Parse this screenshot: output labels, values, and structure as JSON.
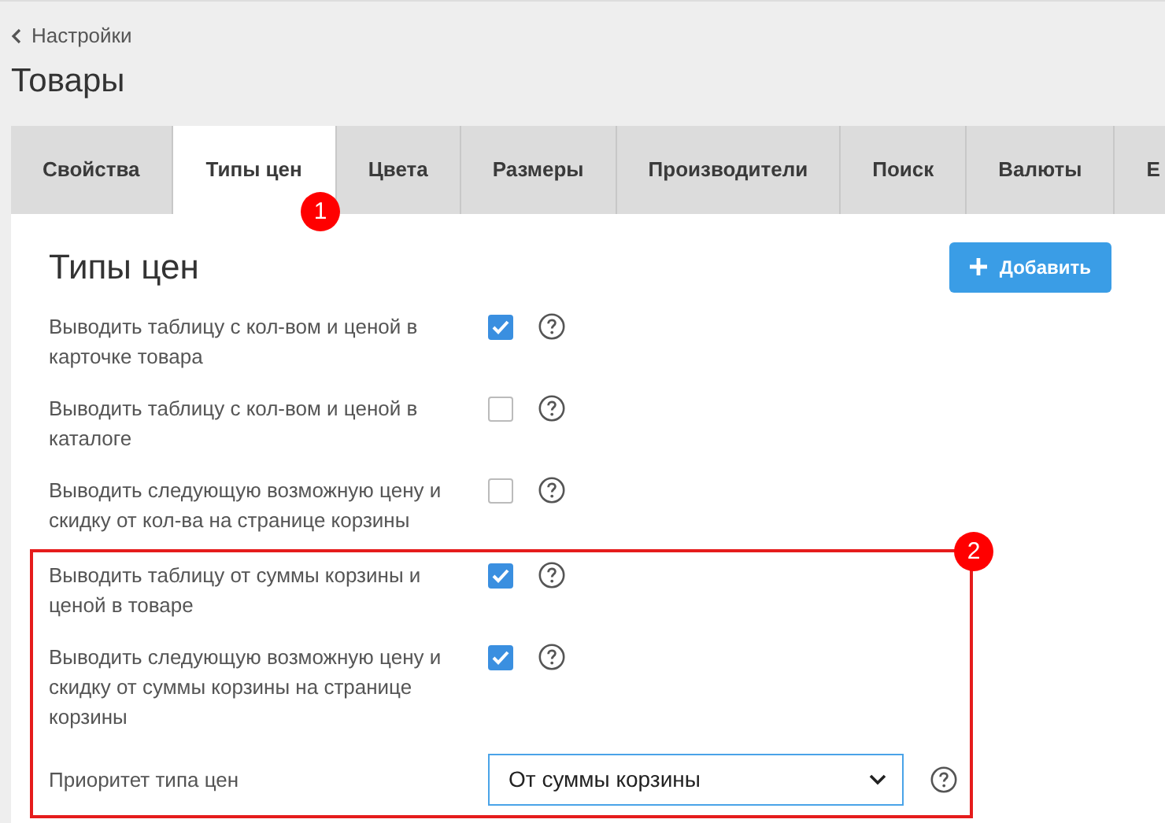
{
  "breadcrumb": {
    "label": "Настройки"
  },
  "title": "Товары",
  "tabs": [
    {
      "label": "Свойства",
      "selected": false
    },
    {
      "label": "Типы цен",
      "selected": true
    },
    {
      "label": "Цвета",
      "selected": false
    },
    {
      "label": "Размеры",
      "selected": false
    },
    {
      "label": "Производители",
      "selected": false
    },
    {
      "label": "Поиск",
      "selected": false
    },
    {
      "label": "Валюты",
      "selected": false
    },
    {
      "label": "Е",
      "selected": false
    }
  ],
  "tab_callout": "1",
  "section": {
    "title": "Типы цен",
    "add_button": "Добавить"
  },
  "settings": [
    {
      "kind": "checkbox",
      "label": "Выводить таблицу с кол-вом и ценой в карточке товара",
      "checked": true
    },
    {
      "kind": "checkbox",
      "label": "Выводить таблицу с кол-вом и ценой в каталоге",
      "checked": false
    },
    {
      "kind": "checkbox",
      "label": "Выводить следующую возможную цену и скидку от кол-ва на странице корзины",
      "checked": false
    }
  ],
  "highlighted_group": {
    "callout": "2",
    "settings": [
      {
        "kind": "checkbox",
        "label": "Выводить таблицу от суммы корзины и ценой в товаре",
        "checked": true
      },
      {
        "kind": "checkbox",
        "label": "Выводить следующую возможную цену и скидку от суммы корзины на странице корзины",
        "checked": true
      },
      {
        "kind": "select",
        "label": "Приоритет типа цен",
        "value": "От суммы корзины"
      }
    ]
  }
}
